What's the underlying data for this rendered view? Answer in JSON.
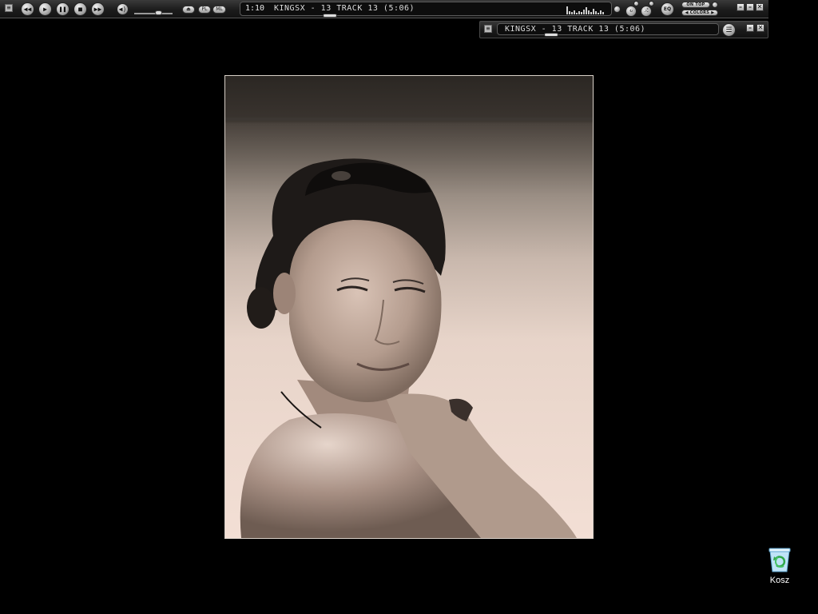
{
  "player": {
    "time": "1:10",
    "track_title": "KINGSX - 13 TRACK 13 (5:06)",
    "playlist_button": "PL",
    "media_library_button": "ML",
    "eq_button": "EQ",
    "on_top_button": "ON TOP",
    "colors_button": "COLORS"
  },
  "playlist_window": {
    "track_title": "KINGSX - 13 TRACK 13 (5:06)"
  },
  "desktop": {
    "recycle_bin_label": "Kosz"
  },
  "icons": {
    "prev": "previous-icon",
    "play": "play-icon",
    "pause": "pause-icon",
    "stop": "stop-icon",
    "next": "next-icon",
    "volume": "speaker-icon",
    "eject": "eject-icon",
    "recycle_bin": "recycle-bin-icon"
  }
}
